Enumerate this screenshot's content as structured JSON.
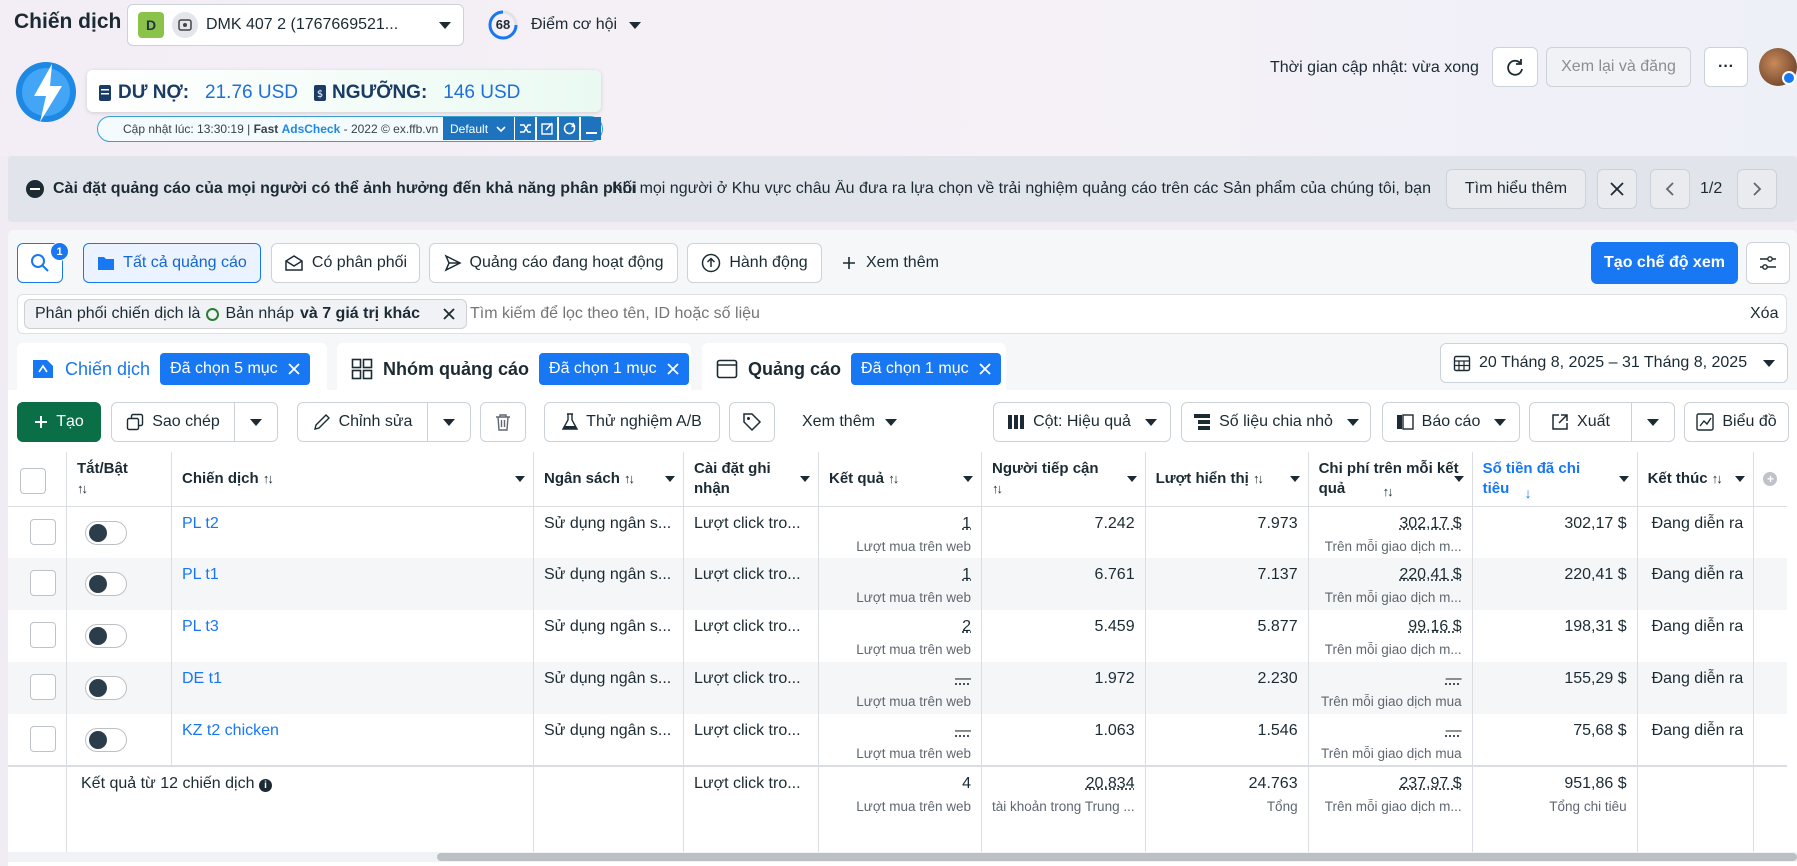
{
  "header": {
    "title": "Chiến dịch",
    "account_letter": "D",
    "account_name": "DMK 407 2 (1767669521...",
    "opportunity_score": "68",
    "opportunity_label": "Điểm cơ hội",
    "update_time": "Thời gian cập nhật: vừa xong",
    "review_publish": "Xem lại và đăng",
    "more": "···"
  },
  "adscheck": {
    "debt_label": "DƯ NỢ:",
    "debt_value": "21.76 USD",
    "threshold_label": "NGƯỠNG:",
    "threshold_value": "146 USD",
    "updated_prefix": "Cập nhật lúc: 13:30:19 |",
    "brand_fast": "Fast",
    "brand_ads": "AdsCheck",
    "suffix": "- 2022 © ex.ffb.vn",
    "mode": "Default"
  },
  "notice": {
    "title": "Cài đặt quảng cáo của mọi người có thể ảnh hưởng đến khả năng phân phối",
    "body": "Khi mọi người ở Khu vực châu Âu đưa ra lựa chọn về trải nghiệm quảng cáo trên các Sản phẩm của chúng tôi, bạn ...",
    "learn_more": "Tìm hiểu thêm",
    "pager": "1/2"
  },
  "toolbar1": {
    "search_badge": "1",
    "all_ads": "Tất cả quảng cáo",
    "delivering": "Có phân phối",
    "active_ads": "Quảng cáo đang hoạt động",
    "actions": "Hành động",
    "see_more": "Xem thêm",
    "create_view": "Tạo chế độ xem"
  },
  "filter": {
    "chip_prefix": "Phân phối chiến dịch là",
    "chip_value": "Bản nháp",
    "chip_suffix": "và 7 giá trị khác",
    "search_placeholder": "Tìm kiếm để lọc theo tên, ID hoặc số liệu",
    "clear": "Xóa"
  },
  "tabs": [
    {
      "label": "Chiến dịch",
      "selected": "Đã chọn 5 mục"
    },
    {
      "label": "Nhóm quảng cáo",
      "selected": "Đã chọn 1 mục"
    },
    {
      "label": "Quảng cáo",
      "selected": "Đã chọn 1 mục"
    }
  ],
  "date_range": "20 Tháng 8, 2025 – 31 Tháng 8, 2025",
  "toolbar2": {
    "create": "Tạo",
    "copy": "Sao chép",
    "edit": "Chỉnh sửa",
    "ab_test": "Thử nghiệm A/B",
    "see_more": "Xem thêm",
    "columns": "Cột: Hiệu quả",
    "breakdown": "Số liệu chia nhỏ",
    "reports": "Báo cáo",
    "export": "Xuất",
    "charts": "Biểu đồ"
  },
  "columns": {
    "toggle": "Tắt/Bật",
    "campaign": "Chiến dịch",
    "budget": "Ngân sách",
    "attribution": "Cài đặt ghi nhận",
    "results": "Kết quả",
    "reach": "Người tiếp cận",
    "impressions": "Lượt hiển thị",
    "cost_per_result": "Chi phí trên mỗi kết quả",
    "amount_spent": "Số tiền đã chi tiêu",
    "ends": "Kết thúc"
  },
  "rows": [
    {
      "name": "PL t2",
      "budget": "Sử dụng ngân s...",
      "attribution": "Lượt click tro...",
      "results": "1",
      "results_sub": "Lượt mua trên web",
      "reach": "7.242",
      "impressions": "7.973",
      "cpr": "302,17 $",
      "cpr_sub": "Trên mỗi giao dịch m...",
      "spent": "302,17 $",
      "ends": "Đang diễn ra"
    },
    {
      "name": "PL t1",
      "budget": "Sử dụng ngân s...",
      "attribution": "Lượt click tro...",
      "results": "1",
      "results_sub": "Lượt mua trên web",
      "reach": "6.761",
      "impressions": "7.137",
      "cpr": "220,41 $",
      "cpr_sub": "Trên mỗi giao dịch m...",
      "spent": "220,41 $",
      "ends": "Đang diễn ra"
    },
    {
      "name": "PL t3",
      "budget": "Sử dụng ngân s...",
      "attribution": "Lượt click tro...",
      "results": "2",
      "results_sub": "Lượt mua trên web",
      "reach": "5.459",
      "impressions": "5.877",
      "cpr": "99,16 $",
      "cpr_sub": "Trên mỗi giao dịch m...",
      "spent": "198,31 $",
      "ends": "Đang diễn ra"
    },
    {
      "name": "DE t1",
      "budget": "Sử dụng ngân s...",
      "attribution": "Lượt click tro...",
      "results": "—",
      "results_sub": "Lượt mua trên web",
      "reach": "1.972",
      "impressions": "2.230",
      "cpr": "—",
      "cpr_sub": "Trên mỗi giao dịch mua",
      "spent": "155,29 $",
      "ends": "Đang diễn ra"
    },
    {
      "name": "KZ t2 chicken",
      "budget": "Sử dụng ngân s...",
      "attribution": "Lượt click tro...",
      "results": "—",
      "results_sub": "Lượt mua trên web",
      "reach": "1.063",
      "impressions": "1.546",
      "cpr": "—",
      "cpr_sub": "Trên mỗi giao dịch mua",
      "spent": "75,68 $",
      "ends": "Đang diễn ra"
    }
  ],
  "totals": {
    "label": "Kết quả từ 12 chiến dịch",
    "attribution": "Lượt click tro...",
    "results": "4",
    "results_sub": "Lượt mua trên web",
    "reach": "20.834",
    "reach_sub": "tài khoản trong Trung ...",
    "impressions": "24.763",
    "impressions_sub": "Tổng",
    "cpr": "237,97 $",
    "cpr_sub": "Trên mỗi giao dịch m...",
    "spent": "951,86 $",
    "spent_sub": "Tổng chi tiêu"
  },
  "colors": {
    "accent": "#1877f2",
    "create_green": "#0a6e47",
    "create_view_blue": "#1877f2"
  }
}
